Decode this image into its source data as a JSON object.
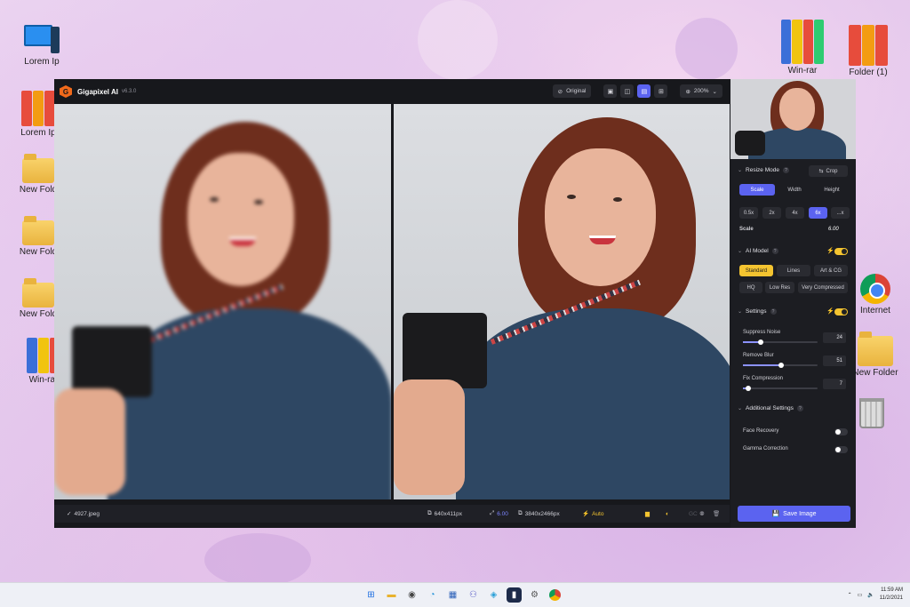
{
  "desktop": {
    "icons": [
      {
        "label": "Lorem Ip"
      },
      {
        "label": "Lorem Ip"
      },
      {
        "label": "New Fold"
      },
      {
        "label": "New Fold"
      },
      {
        "label": "New Fold"
      },
      {
        "label": "Win-rar"
      },
      {
        "label": "Win-rar"
      },
      {
        "label": "Folder (1)"
      },
      {
        "label": "Internet"
      },
      {
        "label": "New Folder"
      }
    ]
  },
  "app": {
    "name": "Gigapixel AI",
    "version": "v6.3.0",
    "logo_letter": "G",
    "toolbar": {
      "original_label": "Original",
      "zoom": "200%"
    },
    "bottom": {
      "filename": "4927.jpeg",
      "input_size": "640x411px",
      "scale": "6.00",
      "output_size": "3840x2466px",
      "auto_label": "Auto",
      "gc_label": "GC"
    },
    "panel": {
      "resize_mode": {
        "title": "Resize Mode",
        "crop_label": "Crop",
        "modes": [
          "Scale",
          "Width",
          "Height"
        ],
        "selected_mode": "Scale",
        "scales": [
          "0.5x",
          "2x",
          "4x",
          "6x",
          "...x"
        ],
        "selected_scale": "6x",
        "scale_label": "Scale",
        "scale_value": "6.00"
      },
      "ai_model": {
        "title": "AI Model",
        "enabled": true,
        "models_row1": [
          "Standard",
          "Lines",
          "Art & CG"
        ],
        "models_row2": [
          "HQ",
          "Low Res",
          "Very Compressed"
        ],
        "selected": "Standard"
      },
      "settings": {
        "title": "Settings",
        "enabled": true,
        "sliders": [
          {
            "label": "Suppress Noise",
            "value": "24",
            "fraction": 0.24
          },
          {
            "label": "Remove Blur",
            "value": "51",
            "fraction": 0.51
          },
          {
            "label": "Fix Compression",
            "value": "7",
            "fraction": 0.07
          }
        ]
      },
      "additional": {
        "title": "Additional Settings",
        "toggles": [
          {
            "label": "Face Recovery",
            "on": false
          },
          {
            "label": "Gamma Correction",
            "on": false
          }
        ]
      },
      "save_label": "Save Image"
    }
  },
  "taskbar": {
    "time": "11:59 AM",
    "date": "11/2/2021"
  },
  "colors": {
    "accent": "#5b63f0",
    "highlight": "#f4c430",
    "app_bg": "#17181c"
  }
}
